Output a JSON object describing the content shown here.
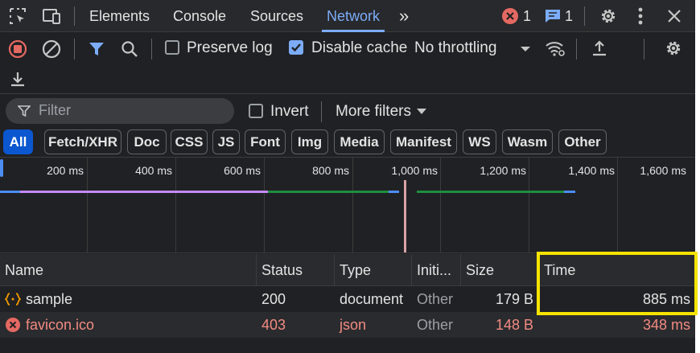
{
  "tabs": {
    "items": [
      "Elements",
      "Console",
      "Sources",
      "Network"
    ],
    "active": "Network",
    "more": "»",
    "error_count": "1",
    "message_count": "1"
  },
  "toolbar": {
    "preserve_log": "Preserve log",
    "disable_cache": "Disable cache",
    "disable_cache_checked": true,
    "preserve_log_checked": false,
    "throttling": "No throttling"
  },
  "filter": {
    "placeholder": "Filter",
    "invert": "Invert",
    "more_filters": "More filters"
  },
  "type_filters": [
    "All",
    "Fetch/XHR",
    "Doc",
    "CSS",
    "JS",
    "Font",
    "Img",
    "Media",
    "Manifest",
    "WS",
    "Wasm",
    "Other"
  ],
  "active_type_filter": "All",
  "overview": {
    "ticks": [
      "200 ms",
      "400 ms",
      "600 ms",
      "800 ms",
      "1,000 ms",
      "1,200 ms",
      "1,400 ms",
      "1,600 ms"
    ]
  },
  "table": {
    "columns": [
      "Name",
      "Status",
      "Type",
      "Initi...",
      "Size",
      "Time"
    ],
    "rows": [
      {
        "name": "sample",
        "status": "200",
        "type": "document",
        "initiator": "Other",
        "size": "179 B",
        "time": "885 ms",
        "icon": "document-icon",
        "error": false
      },
      {
        "name": "favicon.ico",
        "status": "403",
        "type": "json",
        "initiator": "Other",
        "size": "148 B",
        "time": "348 ms",
        "icon": "error-icon",
        "error": true
      }
    ]
  },
  "colors": {
    "accent": "#7cacf8",
    "error": "#f28b82",
    "highlight": "#f5e400",
    "bar_purple": "#c58af9",
    "bar_green": "#1e8e3e",
    "bar_blue": "#4c8df6"
  }
}
